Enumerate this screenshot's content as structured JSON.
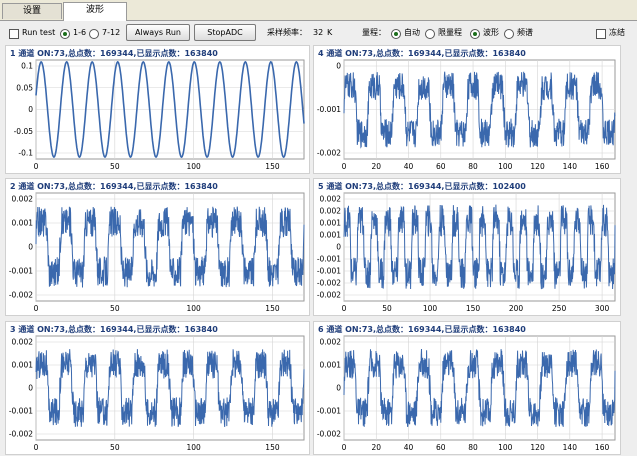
{
  "tabs": [
    {
      "label": "设置",
      "active": false
    },
    {
      "label": "波形",
      "active": true
    }
  ],
  "toolbar": {
    "run_test_label": "Run test",
    "ch_1_6_label": "1-6",
    "ch_7_12_label": "7-12",
    "always_run_label": "Always Run",
    "stop_adc_label": "StopADC",
    "sample_rate_label": "采样频率：",
    "sample_rate_value": "32",
    "sample_rate_unit": "K",
    "range_label": "量程：",
    "auto_label": "自动",
    "limit_label": "限量程",
    "wave_label": "波形",
    "spectrum_label": "频谱",
    "freeze_label": "冻结"
  },
  "colors": {
    "trace": "#3a68ad",
    "grid": "#d4d4d4",
    "title": "#1f3d7a"
  },
  "chart_data": [
    {
      "type": "line",
      "title": "1 通道 ON:73,总点数：169344,已显示点数：163840",
      "yticks": [
        "0.1",
        "0.05",
        "0",
        "-0.05",
        "-0.1"
      ],
      "xticks": [
        "0",
        "50",
        "100",
        "150"
      ],
      "ylim": [
        -0.13,
        0.13
      ],
      "xlim": [
        0,
        170
      ],
      "signal": "sine",
      "amplitude": 0.125,
      "cycles": 10.5,
      "grid": true
    },
    {
      "type": "line",
      "title": "4 通道 ON:73,总点数：169344,已显示点数：163840",
      "yticks": [
        "0",
        "-0.001",
        "-0.002"
      ],
      "xticks": [
        "0",
        "20",
        "40",
        "60",
        "80",
        "100",
        "120",
        "140",
        "160"
      ],
      "ylim": [
        -0.0022,
        0.0012
      ],
      "xlim": [
        0,
        168
      ],
      "signal": "noisy",
      "amplitude": 0.0013,
      "center": -0.0005,
      "cycles": 11,
      "grid": true
    },
    {
      "type": "line",
      "title": "2 通道 ON:73,总点数：169344,已显示点数：163840",
      "yticks": [
        "0.002",
        "0.001",
        "0",
        "-0.001",
        "-0.002"
      ],
      "xticks": [
        "0",
        "50",
        "100",
        "150"
      ],
      "ylim": [
        -0.0028,
        0.0028
      ],
      "xlim": [
        0,
        170
      ],
      "signal": "noisy",
      "amplitude": 0.0021,
      "center": 0,
      "cycles": 11,
      "grid": true
    },
    {
      "type": "line",
      "title": "5 通道 ON:73,总点数：169344,已显示点数：102400",
      "yticks": [
        "0.002",
        "0.002",
        "0.001",
        "0.001",
        "0",
        "-0.001",
        "-0.001",
        "-0.002",
        "-0.002"
      ],
      "xticks": [
        "0",
        "50",
        "100",
        "150",
        "200",
        "250",
        "300"
      ],
      "ylim": [
        -0.0028,
        0.0028
      ],
      "xlim": [
        0,
        315
      ],
      "signal": "noisy",
      "amplitude": 0.0022,
      "center": 0,
      "cycles": 20,
      "grid": true
    },
    {
      "type": "line",
      "title": "3 通道 ON:73,总点数：169344,已显示点数：163840",
      "yticks": [
        "0.002",
        "0.001",
        "0",
        "-0.001",
        "-0.002"
      ],
      "xticks": [
        "0",
        "50",
        "100",
        "150"
      ],
      "ylim": [
        -0.0028,
        0.0028
      ],
      "xlim": [
        0,
        170
      ],
      "signal": "noisy",
      "amplitude": 0.0021,
      "center": 0,
      "cycles": 11,
      "grid": true
    },
    {
      "type": "line",
      "title": "6 通道 ON:73,总点数：169344,已显示点数：163840",
      "yticks": [
        "0.002",
        "0.001",
        "0",
        "-0.001",
        "-0.002"
      ],
      "xticks": [
        "0",
        "20",
        "40",
        "60",
        "80",
        "100",
        "120",
        "140",
        "160"
      ],
      "ylim": [
        -0.0028,
        0.0028
      ],
      "xlim": [
        0,
        168
      ],
      "signal": "noisy",
      "amplitude": 0.0021,
      "center": 0,
      "cycles": 11,
      "grid": true
    }
  ]
}
